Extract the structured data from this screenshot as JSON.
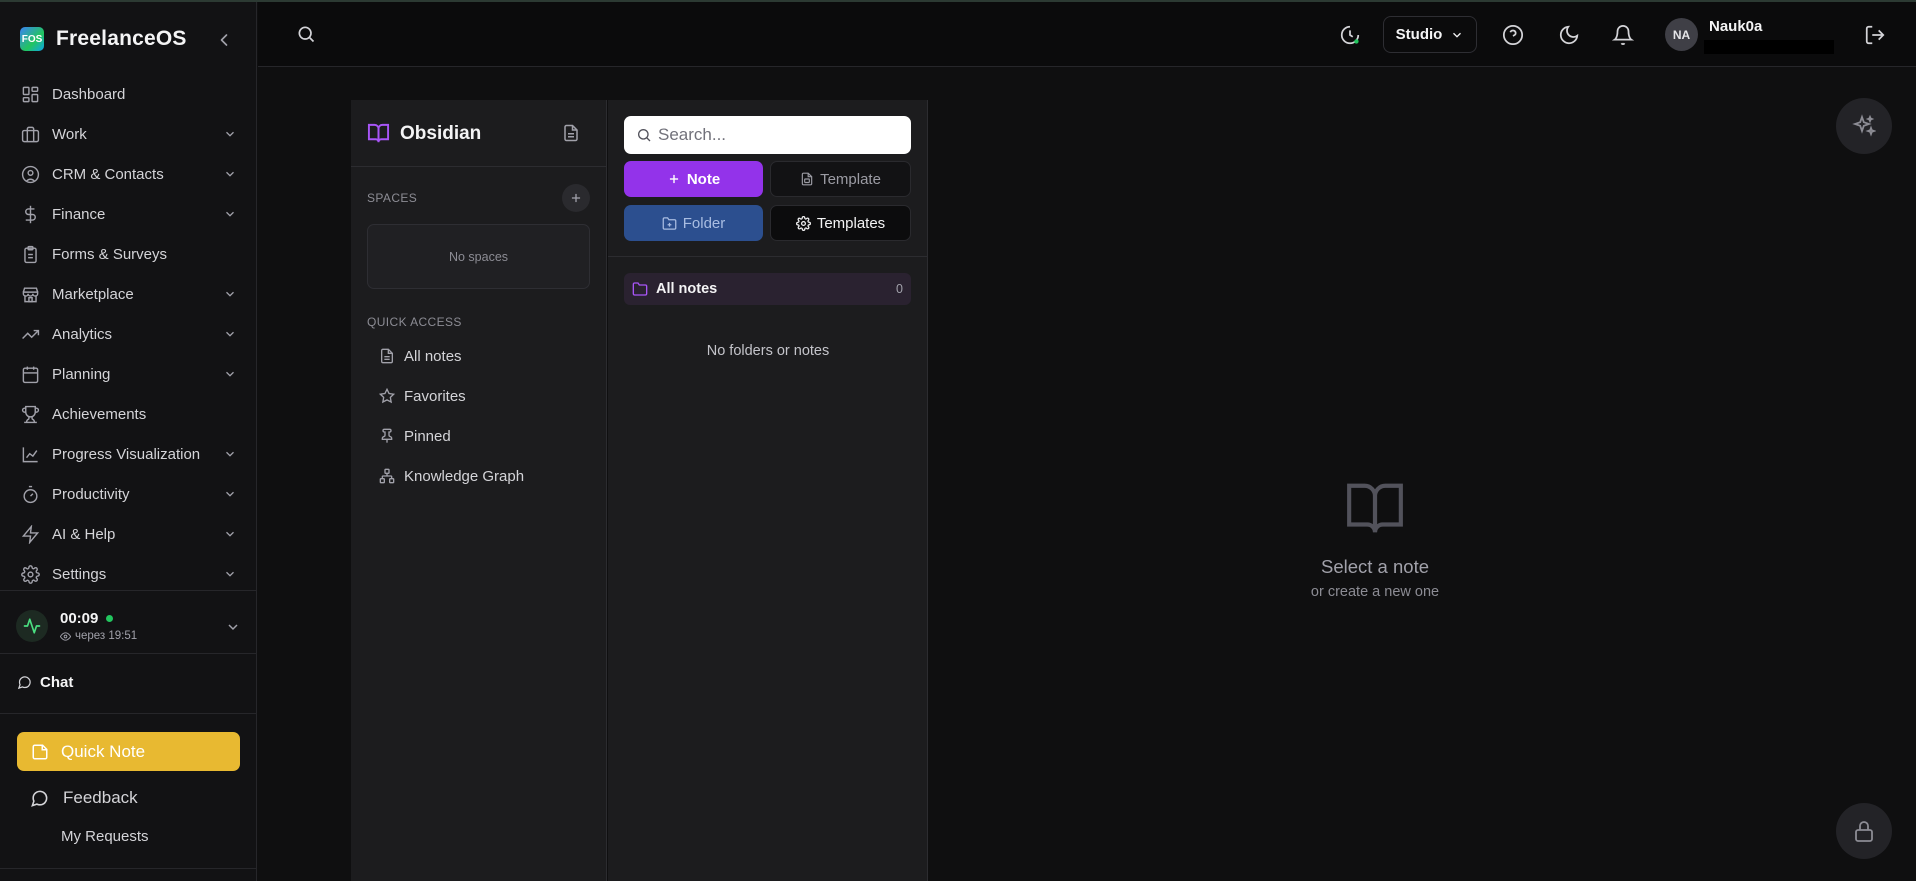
{
  "app": {
    "name": "FreelanceOS",
    "logo_text": "FOS"
  },
  "sidebar": {
    "items": [
      {
        "label": "Dashboard",
        "icon": "dashboard-icon",
        "has_chevron": false
      },
      {
        "label": "Work",
        "icon": "briefcase-icon",
        "has_chevron": true
      },
      {
        "label": "CRM & Contacts",
        "icon": "user-circle-icon",
        "has_chevron": true
      },
      {
        "label": "Finance",
        "icon": "dollar-icon",
        "has_chevron": true
      },
      {
        "label": "Forms & Surveys",
        "icon": "clipboard-icon",
        "has_chevron": false
      },
      {
        "label": "Marketplace",
        "icon": "store-icon",
        "has_chevron": true
      },
      {
        "label": "Analytics",
        "icon": "trending-icon",
        "has_chevron": true
      },
      {
        "label": "Planning",
        "icon": "calendar-icon",
        "has_chevron": true
      },
      {
        "label": "Achievements",
        "icon": "trophy-icon",
        "has_chevron": false
      },
      {
        "label": "Progress Visualization",
        "icon": "line-chart-icon",
        "has_chevron": true
      },
      {
        "label": "Productivity",
        "icon": "timer-icon",
        "has_chevron": true
      },
      {
        "label": "AI & Help",
        "icon": "bolt-icon",
        "has_chevron": true
      },
      {
        "label": "Settings",
        "icon": "gear-icon",
        "has_chevron": true
      }
    ],
    "timer": {
      "time": "00:09",
      "sub": "через 19:51"
    },
    "chat_label": "Chat",
    "quick_note_label": "Quick Note",
    "feedback_label": "Feedback",
    "my_requests_label": "My Requests"
  },
  "topbar": {
    "workspace": "Studio",
    "avatar_initials": "NA",
    "username": "Nauk0a"
  },
  "obsidian": {
    "title": "Obsidian",
    "spaces_label": "SPACES",
    "no_spaces": "No spaces",
    "quick_access_label": "QUICK ACCESS",
    "quick_access": [
      {
        "label": "All notes",
        "icon": "file-icon"
      },
      {
        "label": "Favorites",
        "icon": "star-icon"
      },
      {
        "label": "Pinned",
        "icon": "pin-icon"
      },
      {
        "label": "Knowledge Graph",
        "icon": "graph-icon"
      }
    ]
  },
  "notes_list": {
    "search_placeholder": "Search...",
    "note_btn": "Note",
    "template_btn": "Template",
    "folder_btn": "Folder",
    "templates_btn": "Templates",
    "all_notes_label": "All notes",
    "all_notes_count": "0",
    "empty_text": "No folders or notes"
  },
  "empty_state": {
    "title": "Select a note",
    "subtitle": "or create a new one"
  },
  "colors": {
    "accent_purple": "#9333ea",
    "folder_blue": "#2c4f8f",
    "quick_note_yellow": "#e8b931",
    "status_green": "#22c55e"
  }
}
